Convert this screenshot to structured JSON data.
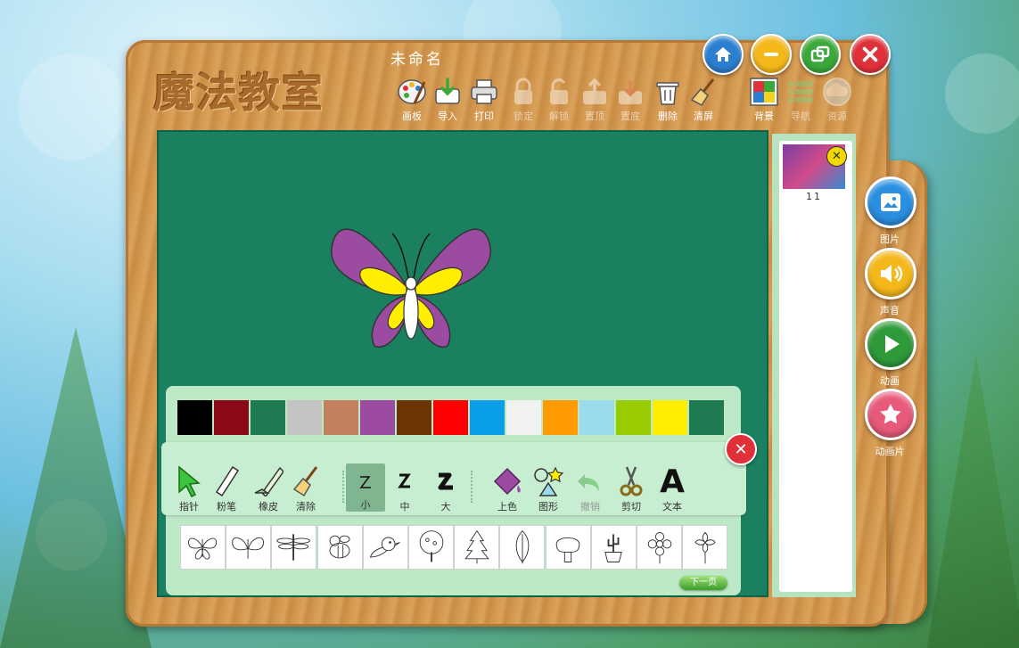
{
  "app": {
    "logo_text": "魔法教室",
    "document_title": "未命名"
  },
  "window_controls": [
    {
      "name": "home-button",
      "icon": "home-icon",
      "color": "#2a7fd0"
    },
    {
      "name": "minimize-button",
      "icon": "minus-icon",
      "color": "#f5b81b"
    },
    {
      "name": "restore-button",
      "icon": "restore-icon",
      "color": "#3aa83a"
    },
    {
      "name": "close-button",
      "icon": "close-icon",
      "color": "#e0303a"
    }
  ],
  "toolbar": {
    "palette": "画板",
    "import": "导入",
    "print": "打印",
    "lock": "锁定",
    "unlock": "解锁",
    "set_top": "置顶",
    "set_bottom": "置底",
    "delete": "删除",
    "clear": "清屏",
    "background": "背景",
    "navigate": "导航",
    "resources": "资源"
  },
  "colors": [
    "#000000",
    "#8b0a1a",
    "#1e7a50",
    "#c4c4c4",
    "#c28060",
    "#9b4ca0",
    "#6b3505",
    "#ff0000",
    "#0aa0e8",
    "#f2f2f2",
    "#ff9a00",
    "#9cdbec",
    "#99cc00",
    "#ffee00",
    "#1e7a50"
  ],
  "tools": {
    "pointer": "指针",
    "chalk": "粉笔",
    "eraser": "橡皮",
    "clear": "清除",
    "small": "小",
    "medium": "中",
    "large": "大",
    "fill": "上色",
    "shape": "图形",
    "undo": "撤销",
    "cut": "剪切",
    "text": "文本",
    "text_glyph": "A"
  },
  "stamps": [
    "butterfly-1",
    "butterfly-2",
    "dragonfly",
    "bee",
    "bird",
    "tree-round",
    "pine-tree",
    "leaf",
    "tree",
    "potted-cactus",
    "flower",
    "flower-2"
  ],
  "next_page": "下一页",
  "thumbnail": {
    "number": "11"
  },
  "side": {
    "picture": "图片",
    "sound": "声音",
    "animation": "动画",
    "animation_clip": "动画片"
  }
}
